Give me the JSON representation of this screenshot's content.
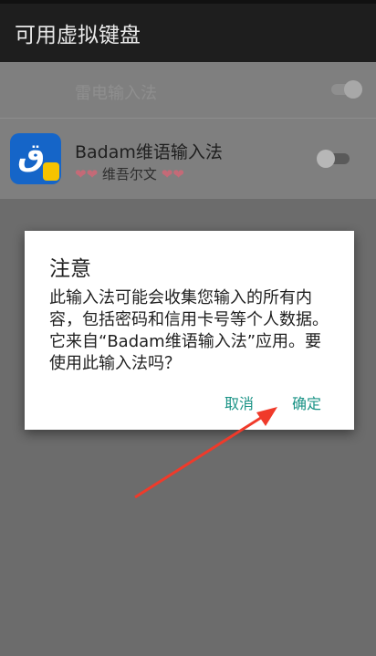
{
  "appbar": {
    "title": "可用虚拟键盘"
  },
  "list": {
    "items": [
      {
        "label": "雷电输入法",
        "toggle_on": true
      },
      {
        "label": "Badam维语输入法",
        "subtitle": "维吾尔文",
        "icon": "badam-keyboard-icon",
        "toggle_on": false
      }
    ]
  },
  "dialog": {
    "title": "注意",
    "message": "此输入法可能会收集您输入的所有内容，包括密码和信用卡号等个人数据。它来自“Badam维语输入法”应用。要使用此输入法吗？",
    "cancel_label": "取消",
    "ok_label": "确定"
  },
  "colors": {
    "dialog_button": "#1a9386",
    "annotation_arrow": "#f03a2a",
    "appbar_bg": "#1e1e1e",
    "app_icon_bg": "#1565c8"
  }
}
